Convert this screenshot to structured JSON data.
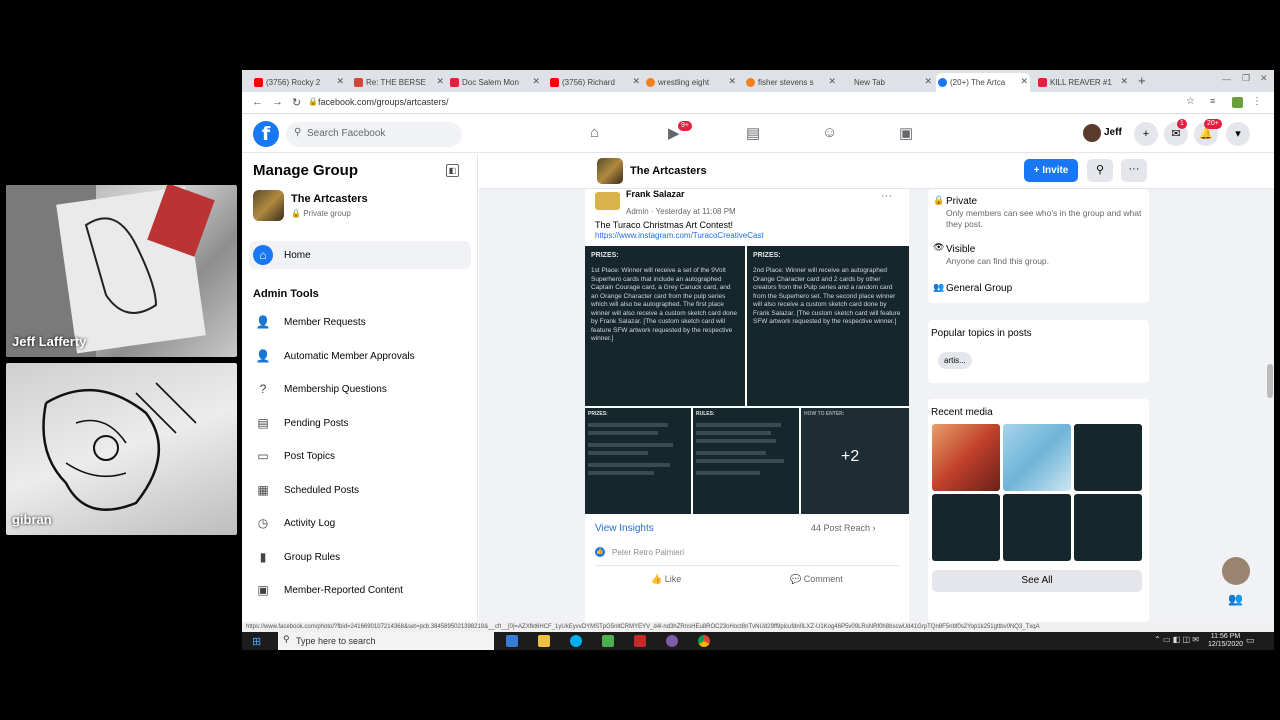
{
  "participants": [
    {
      "name": "Jeff Lafferty"
    },
    {
      "name": "gibran"
    }
  ],
  "browser": {
    "tabs": [
      {
        "label": "(3756) Rocky 2",
        "color": "#ff0000"
      },
      {
        "label": "Re: THE BERSE",
        "color": "#d44638"
      },
      {
        "label": "Doc Salem Mon",
        "color": "#e41e3f"
      },
      {
        "label": "(3756) Richard",
        "color": "#ff0000"
      },
      {
        "label": "wrestling eight",
        "color": "#f38020"
      },
      {
        "label": "fisher stevens s",
        "color": "#f38020"
      },
      {
        "label": "New Tab",
        "color": "#ffffff"
      },
      {
        "label": "(20+) The Artca",
        "color": "#1877f2"
      },
      {
        "label": "KILL REAVER #1",
        "color": "#e41e3f"
      }
    ],
    "url": "facebook.com/groups/artcasters/",
    "status_url": "https://www.facebook.com/photo/?fbid=2416690107214368&set=pcb.3845895021398218&__cft__[0]=AZXfkt6HCF_1yUkEyvvDYMSTpG5nltCRMYEYV_d4l-nd3hZRnsHEu8ROC23oHoct8nTvNUd29ff9plcufdn0LXZ-U1Kog46P5v09LRsNRf0h8bscwUd41GrpTQn8F5nbf0s2Yop1k251gttbv0NQ3_TxqA"
  },
  "fb": {
    "search_placeholder": "Search Facebook",
    "video_badge": "9+",
    "notif_badge": "20+",
    "messenger_badge": "1",
    "user": "Jeff"
  },
  "sidebar": {
    "title": "Manage Group",
    "group_name": "The Artcasters",
    "group_privacy": "Private group",
    "home_label": "Home",
    "admin_tools_label": "Admin Tools",
    "items": [
      {
        "label": "Member Requests",
        "icon": "person-icon"
      },
      {
        "label": "Automatic Member Approvals",
        "icon": "person-check-icon"
      },
      {
        "label": "Membership Questions",
        "icon": "question-icon"
      },
      {
        "label": "Pending Posts",
        "icon": "pending-icon"
      },
      {
        "label": "Post Topics",
        "icon": "tag-icon"
      },
      {
        "label": "Scheduled Posts",
        "icon": "calendar-icon"
      },
      {
        "label": "Activity Log",
        "icon": "clock-icon"
      },
      {
        "label": "Group Rules",
        "icon": "book-icon"
      },
      {
        "label": "Member-Reported Content",
        "icon": "flag-icon"
      }
    ]
  },
  "group_header": {
    "name": "The Artcasters",
    "invite_label": "+ Invite"
  },
  "post": {
    "author": "Frank Salazar",
    "meta": "Admin · Yesterday at 11:08 PM",
    "text": "The Turaco Christmas Art Contest!",
    "link": "https://www.instagram.com/TuracoCreativeCast",
    "prizes_title": "PRIZES:",
    "first_place": "1st Place: Winner will receive a set of the 9Volt Superhero cards that include an autographed Captain Courage card, a Grey Canuck card, and an Orange Character card from the pulp series which will also be autographed. The first place winner will also receive a custom sketch card done by Frank Salazar. [The custom sketch card will feature SFW artwork requested by the respective winner.]",
    "second_place": "2nd Place: Winner will receive an autographed Orange Character card and 2 cards by other creators from the Pulp series and a random card from the Superhero set. The second place winner will also receive a custom sketch card done by Frank Salazar. [The custom sketch card will feature SFW artwork requested by the respective winner.]",
    "thumb_labels": [
      "PRIZES:",
      "RULES:",
      "HOW TO ENTER:"
    ],
    "more_count": "+2",
    "insights_label": "View Insights",
    "reach_label": "44 Post Reach",
    "reactor": "Peter Retro Palmieri",
    "like_label": "Like",
    "comment_label": "Comment"
  },
  "about": {
    "private_title": "Private",
    "private_desc": "Only members can see who's in the group and what they post.",
    "visible_title": "Visible",
    "visible_desc": "Anyone can find this group.",
    "type": "General Group"
  },
  "topics": {
    "title": "Popular topics in posts",
    "chip": "artis..."
  },
  "media": {
    "title": "Recent media",
    "see_all": "See All"
  },
  "taskbar": {
    "search_placeholder": "Type here to search",
    "time": "11:56 PM",
    "date": "12/15/2020"
  }
}
